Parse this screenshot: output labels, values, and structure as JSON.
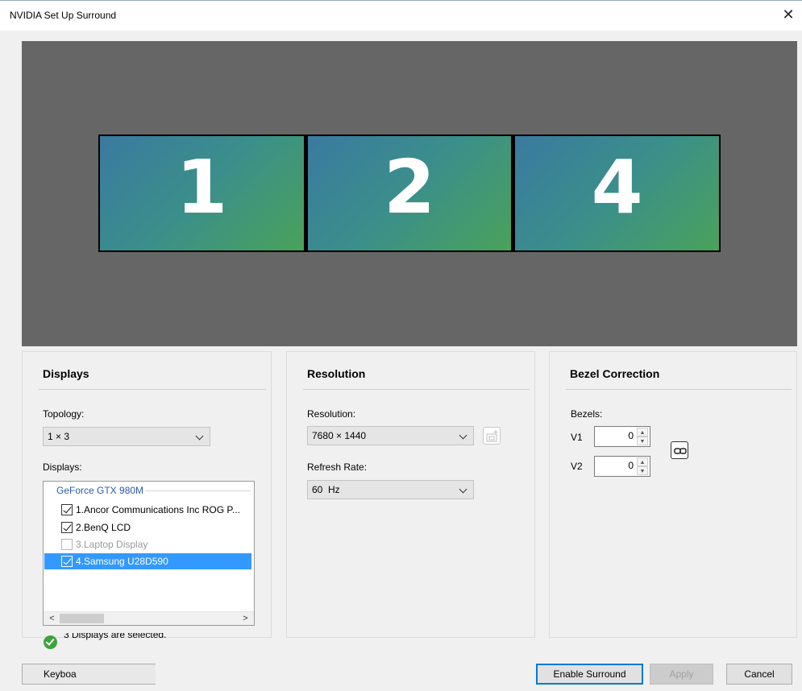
{
  "window": {
    "title": "NVIDIA Set Up Surround",
    "close_glyph": "✕"
  },
  "preview": {
    "monitors": [
      "1",
      "2",
      "4"
    ],
    "gradient_colors": [
      "#3a7aa0",
      "#4aa25a"
    ],
    "background": "#666666"
  },
  "displays_panel": {
    "title": "Displays",
    "topology_label": "Topology:",
    "topology_value": "1 × 3",
    "displays_label": "Displays:",
    "group_name": "GeForce GTX 980M",
    "items": [
      {
        "label": "1.Ancor Communications Inc ROG P...",
        "checked": true,
        "enabled": true,
        "selected": false
      },
      {
        "label": "2.BenQ LCD",
        "checked": true,
        "enabled": true,
        "selected": false
      },
      {
        "label": "3.Laptop Display",
        "checked": false,
        "enabled": false,
        "selected": false
      },
      {
        "label": "4.Samsung U28D590",
        "checked": true,
        "enabled": true,
        "selected": true
      }
    ],
    "scroll_left": "<",
    "scroll_right": ">"
  },
  "status": {
    "text": "3 Displays are selected.",
    "icon": "check-circle-icon",
    "color": "#3fa33f"
  },
  "resolution_panel": {
    "title": "Resolution",
    "resolution_label": "Resolution:",
    "resolution_value": "7680 × 1440",
    "refresh_label": "Refresh Rate:",
    "refresh_value": "60  Hz"
  },
  "bezel_panel": {
    "title": "Bezel Correction",
    "bezels_label": "Bezels:",
    "v1_label": "V1",
    "v1_value": "0",
    "v2_label": "V2",
    "v2_value": "0",
    "link_icon": "link-icon"
  },
  "buttons": {
    "keyboard": "Keyboa",
    "enable_surround": "Enable Surround",
    "apply": "Apply",
    "cancel": "Cancel"
  },
  "accent_color": "#3399ff"
}
